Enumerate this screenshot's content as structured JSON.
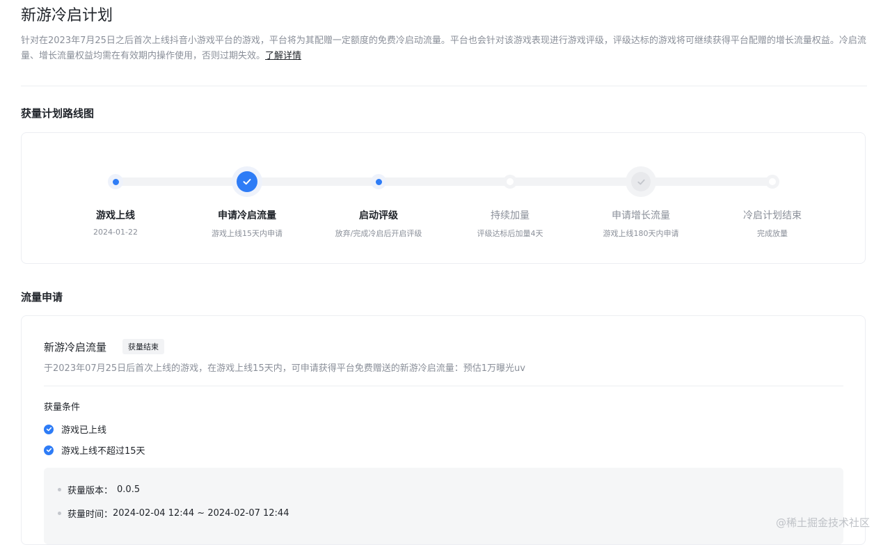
{
  "header": {
    "title": "新游冷启计划",
    "description": "针对在2023年7月25日之后首次上线抖音小游戏平台的游戏，平台将为其配赠一定额度的免费冷启动流量。平台也会针对该游戏表现进行游戏评级，评级达标的游戏将可继续获得平台配赠的增长流量权益。冷启流量、增长流量权益均需在有效期内操作使用，否则过期失效。",
    "learn_more": "了解详情"
  },
  "roadmap": {
    "title": "获量计划路线图",
    "steps": [
      {
        "label": "游戏上线",
        "sub": "2024-01-22",
        "state": "done"
      },
      {
        "label": "申请冷启流量",
        "sub": "游戏上线15天内申请",
        "state": "done"
      },
      {
        "label": "启动评级",
        "sub": "放弃/完成冷启后开启评级",
        "state": "done"
      },
      {
        "label": "持续加量",
        "sub": "评级达标后加量4天",
        "state": "todo"
      },
      {
        "label": "申请增长流量",
        "sub": "游戏上线180天内申请",
        "state": "todo"
      },
      {
        "label": "冷启计划结束",
        "sub": "完成放量",
        "state": "todo"
      }
    ]
  },
  "apply": {
    "title": "流量申请",
    "card": {
      "name": "新游冷启流量",
      "badge": "获量结束",
      "description": "于2023年07月25日后首次上线的游戏，在游戏上线15天内，可申请获得平台免费赠送的新游冷启流量：预估1万曝光uv",
      "conditions_title": "获量条件",
      "conditions": [
        "游戏已上线",
        "游戏上线不超过15天"
      ],
      "info": {
        "version_label": "获量版本：",
        "version_value": "0.0.5",
        "time_label": "获量时间：",
        "time_value": "2024-02-04 12:44 ~ 2024-02-07 12:44"
      }
    }
  },
  "watermark": "@稀土掘金技术社区",
  "colors": {
    "accent": "#2e7cf6",
    "muted": "#8a8f99",
    "text": "#1f2329"
  }
}
